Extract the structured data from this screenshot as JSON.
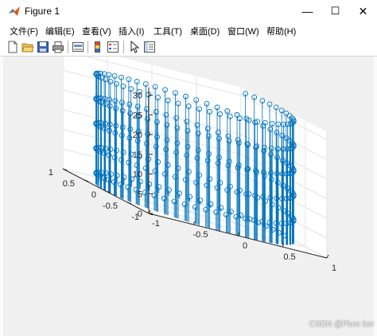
{
  "window": {
    "title": "Figure 1",
    "controls": {
      "minimize": "—",
      "maximize": "☐",
      "close": "✕"
    }
  },
  "menu": [
    "文件(F)",
    "编辑(E)",
    "查看(V)",
    "插入(I)",
    "工具(T)",
    "桌面(D)",
    "窗口(W)",
    "帮助(H)"
  ],
  "toolbar": {
    "icons": [
      "new-figure-icon",
      "open-file-icon",
      "save-icon",
      "print-icon",
      "link-plot-icon",
      "insert-colorbar-icon",
      "insert-legend-icon",
      "edit-plot-icon",
      "property-inspector-icon"
    ]
  },
  "watermark": "CSDN @Plum ber",
  "colors": {
    "series": "#0072bd",
    "axes": "#262626",
    "grid": "#e3e3e3",
    "background": "#f0f0f0"
  },
  "chart_data": {
    "type": "stem3-helix",
    "marker": "circle",
    "x": "cos(t)",
    "y": "sin(t)",
    "z": "t",
    "t_range": [
      0,
      32
    ],
    "z_ticks": [
      0,
      5,
      10,
      15,
      20,
      25,
      30
    ],
    "x_ticks": [
      -1,
      -0.5,
      0,
      0.5,
      1
    ],
    "y_ticks": [
      -1,
      -0.5,
      0,
      0.5,
      1
    ],
    "x_tick_labels": [
      "-1",
      "-0.5",
      "0",
      "0.5",
      "1"
    ],
    "y_tick_labels": [
      "-1",
      "-0.5",
      "0",
      "0.5",
      "1"
    ],
    "z_tick_labels": [
      "0",
      "5",
      "10",
      "15",
      "20",
      "25",
      "30"
    ],
    "xlim": [
      -1,
      1
    ],
    "ylim": [
      -1,
      1
    ],
    "zlim": [
      0,
      32
    ],
    "grid": true
  }
}
